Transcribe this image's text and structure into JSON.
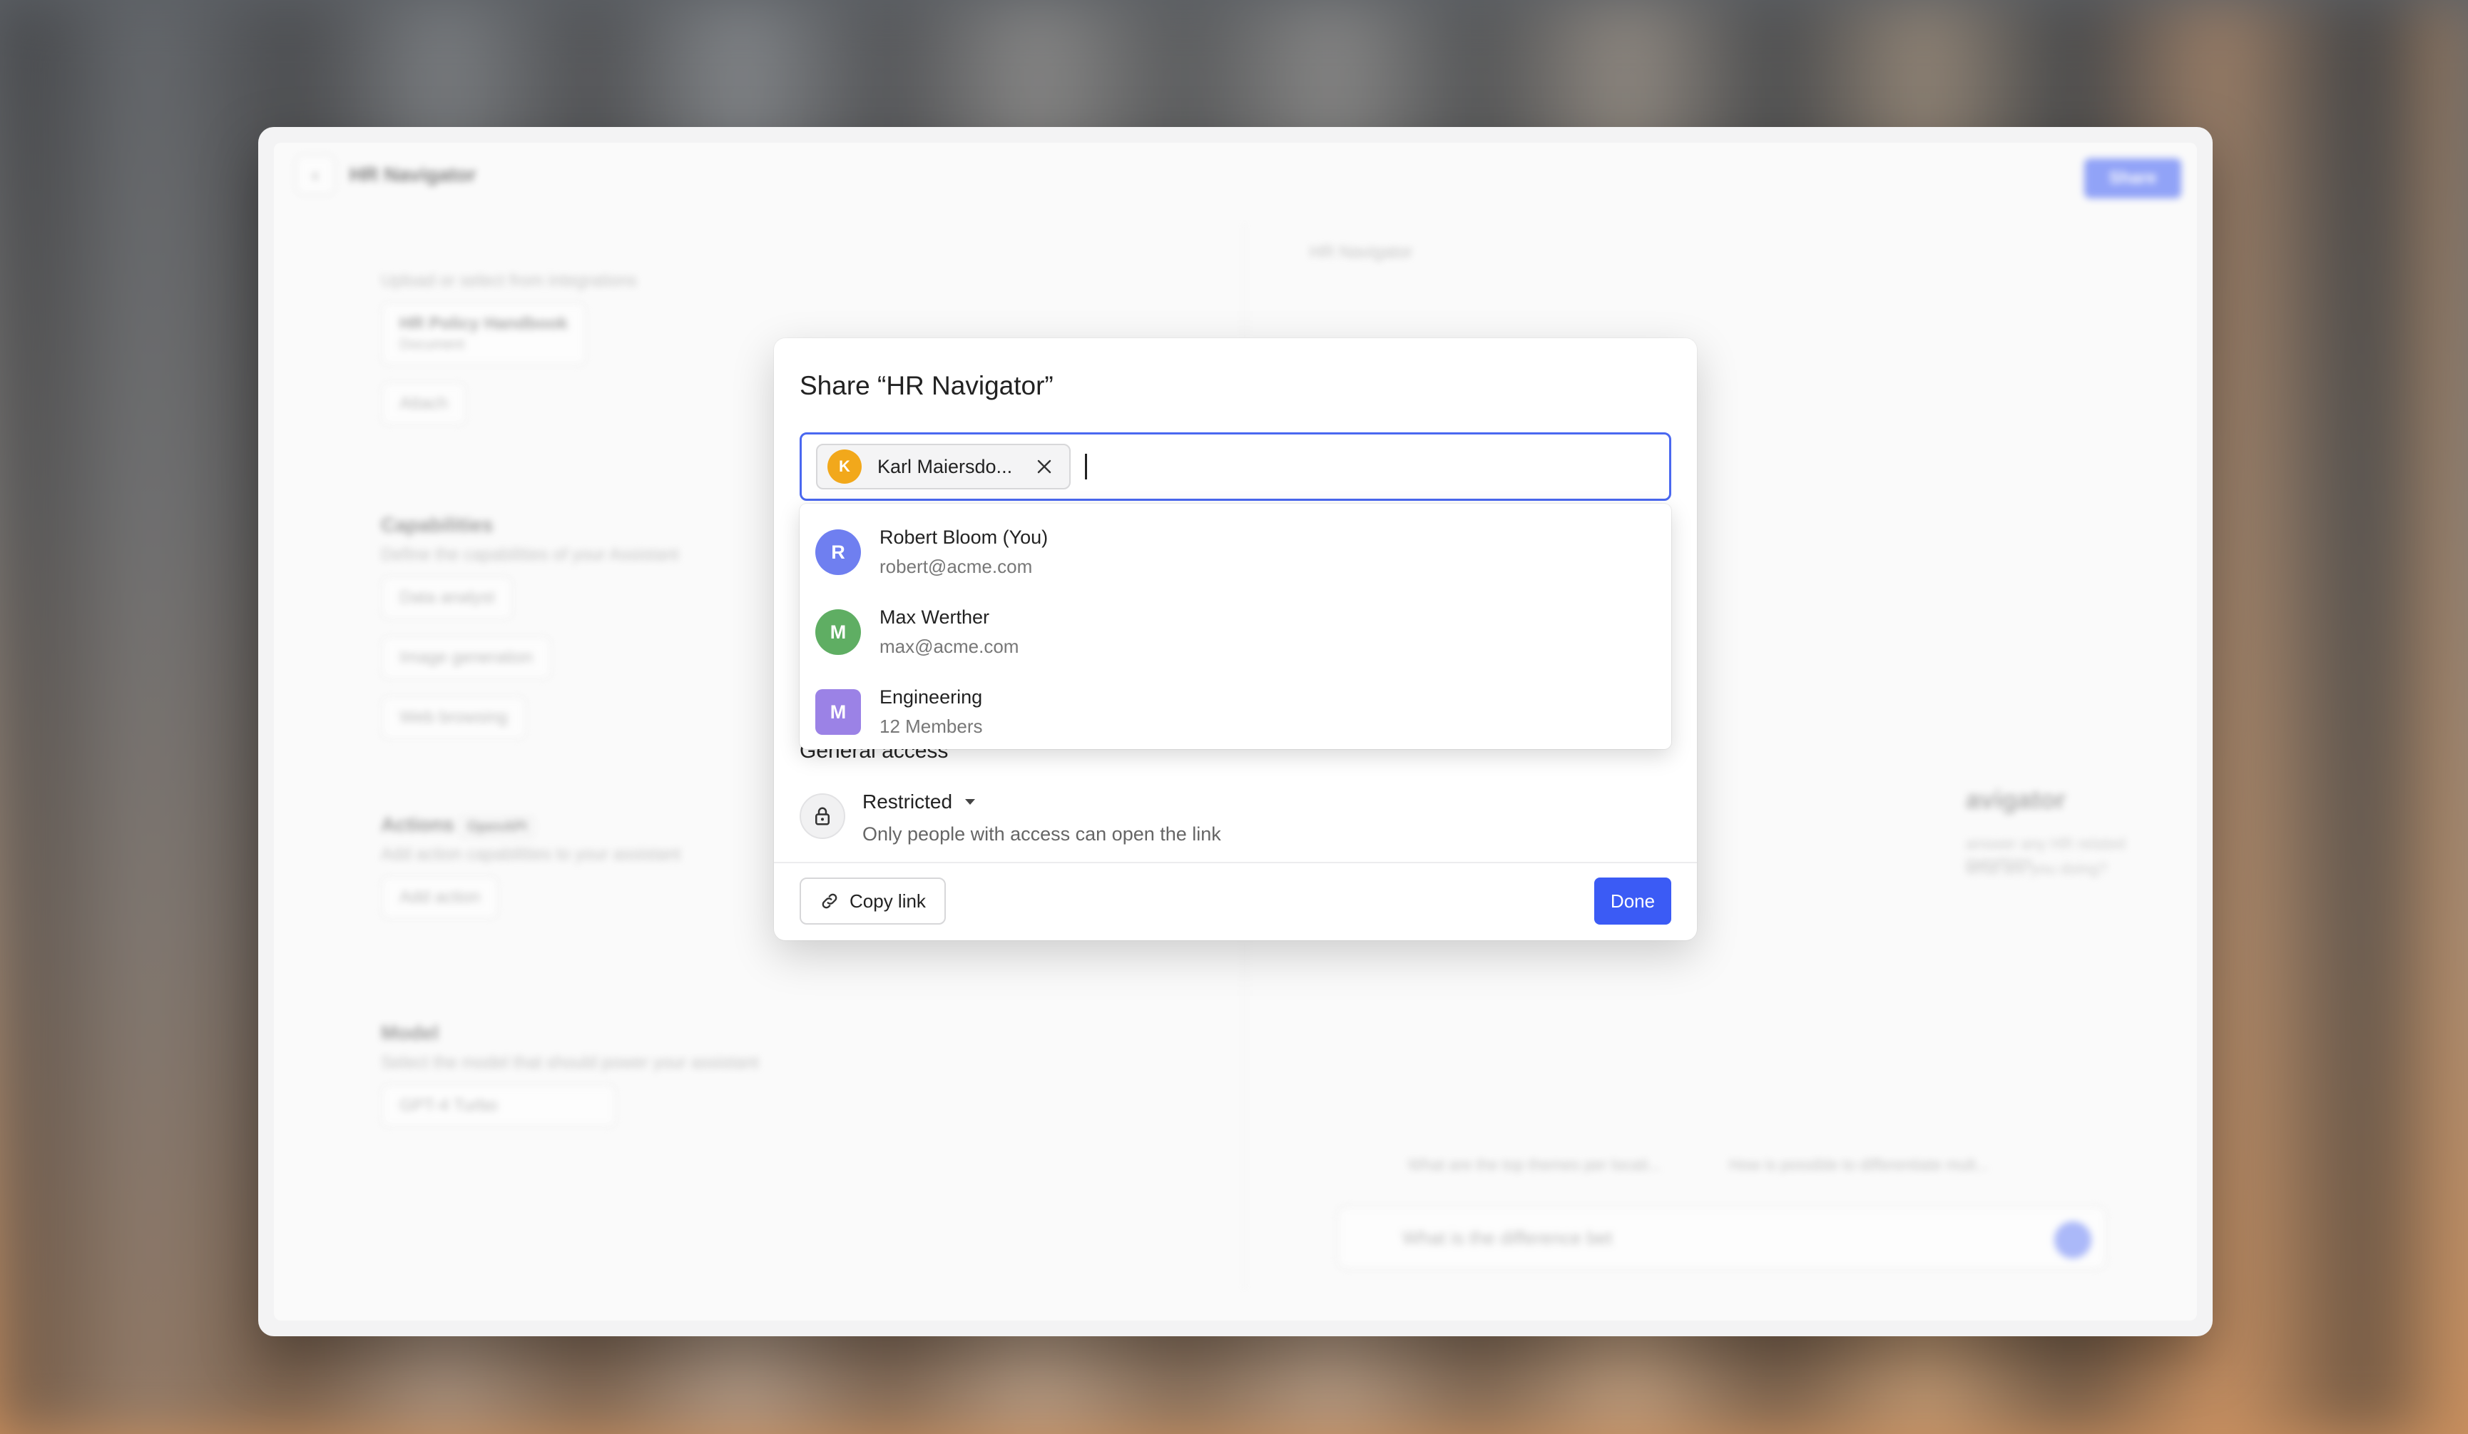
{
  "background_app": {
    "title": "HR Navigator",
    "share_button": "Share",
    "knowledge_sub": "Upload or select from integrations",
    "file_name": "HR Policy Handbook",
    "file_sub": "Document",
    "attach": "Attach",
    "capabilities_heading": "Capabilities",
    "capabilities_sub": "Define the capabilities of your Assistant",
    "cap_items": [
      "Data analyst",
      "Image generation",
      "Web browsing"
    ],
    "actions_heading": "Actions",
    "actions_badge": "OpenAPI",
    "actions_sub": "Add action capabilities to your assistant",
    "add_action": "Add action",
    "model_heading": "Model",
    "model_sub": "Select the model that should power your assistant",
    "model_value": "GPT-4 Turbo",
    "preview_title": "HR Navigator",
    "preview_big": "avigator",
    "preview_desc1": "answer any HR related questions",
    "preview_desc2": "what are you doing?",
    "suggestion_1": "What are the top themes per locati...",
    "suggestion_2": "How is possible to differentiate mult...",
    "chat_placeholder": "What is the difference bet"
  },
  "modal": {
    "title": "Share “HR Navigator”",
    "chip": {
      "initial": "K",
      "name": "Karl Maiersdo...",
      "color": "#f2a81b"
    },
    "suggestions": [
      {
        "initial": "R",
        "name": "Robert Bloom (You)",
        "sub": "robert@acme.com",
        "color": "#6f7ff0",
        "shape": "circle"
      },
      {
        "initial": "M",
        "name": "Max Werther",
        "sub": "max@acme.com",
        "color": "#5fae63",
        "shape": "circle"
      },
      {
        "initial": "M",
        "name": "Engineering",
        "sub": "12 Members",
        "color": "#9b82e6",
        "shape": "square"
      }
    ],
    "general_access_label": "General access",
    "access_value": "Restricted",
    "access_desc": "Only people with access can open the link",
    "copy_link": "Copy link",
    "done": "Done"
  },
  "colors": {
    "accent": "#3b5bf5",
    "focus_border": "#4a68f0"
  }
}
